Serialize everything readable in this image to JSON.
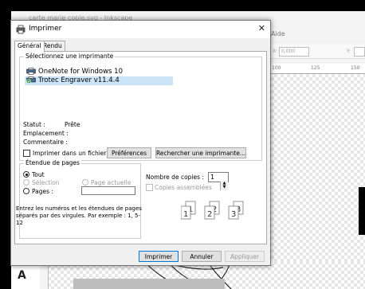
{
  "background": {
    "app_title": "carte marie copie.svg - Inkscape",
    "menu_help": "Aide",
    "coord_x": "0,000",
    "coord_y_label": "Y:",
    "coord_x_label": "X:",
    "ruler_ticks": [
      "100",
      "125",
      "150"
    ]
  },
  "dialog": {
    "title": "Imprimer",
    "tabs": [
      {
        "label": "Général",
        "active": true
      },
      {
        "label": "Rendu",
        "active": false
      }
    ],
    "select_printer": {
      "legend": "Sélectionnez une imprimante",
      "printers": [
        {
          "name": "OneNote for Windows 10",
          "selected": false,
          "icon": "printer-icon"
        },
        {
          "name": "Trotec Engraver v11.4.4",
          "selected": true,
          "icon": "printer-default-icon"
        }
      ],
      "status_label": "Statut :",
      "status_value": "Prête",
      "location_label": "Emplacement :",
      "location_value": "",
      "comment_label": "Commentaire :",
      "comment_value": "",
      "print_to_file_label": "Imprimer dans un fichier",
      "print_to_file_checked": false,
      "preferences_label": "Préférences",
      "find_printer_label": "Rechercher une imprimante..."
    },
    "page_range": {
      "legend": "Étendue de pages",
      "all_label": "Tout",
      "selection_label": "Sélection",
      "current_page_label": "Page actuelle",
      "pages_label": "Pages :",
      "pages_value": "",
      "selected": "all",
      "help_text": "Entrez les numéros et les étendues de pages séparés par des virgules. Par exemple : 1, 5-12"
    },
    "copies": {
      "count_label": "Nombre de copies :",
      "count_value": "1",
      "collate_label": "Copies assemblées",
      "collate_checked": false
    },
    "buttons": {
      "print": "Imprimer",
      "cancel": "Annuler",
      "apply": "Appliquer"
    }
  }
}
